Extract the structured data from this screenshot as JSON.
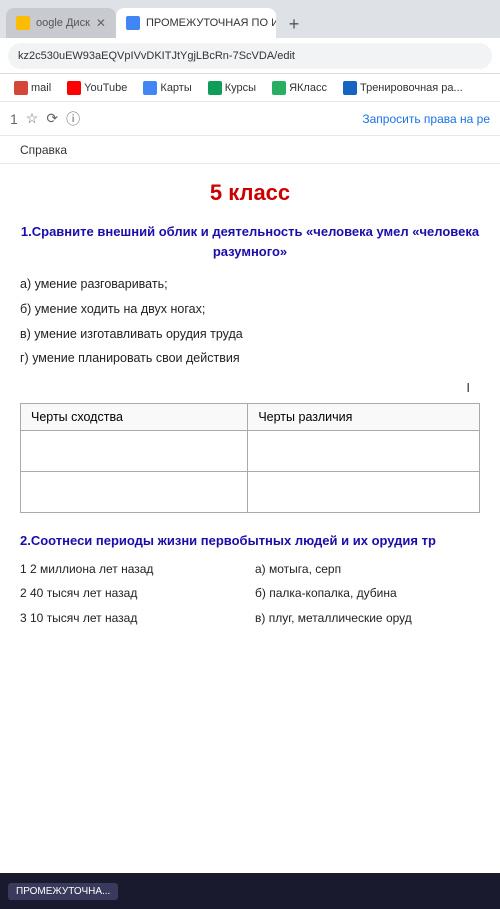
{
  "browser": {
    "tabs": [
      {
        "id": "tab1",
        "label": "oogle Диск",
        "active": false,
        "favicon": "drive"
      },
      {
        "id": "tab2",
        "label": "ПРОМЕЖУТОЧНАЯ ПО ИСТОР",
        "active": true,
        "favicon": "docs"
      }
    ],
    "address": "kz2c530uEW93aEQVpIVvDKITJtYgjLBcRn-7ScVDA/edit",
    "bookmarks": [
      {
        "id": "bm1",
        "label": "mail",
        "iconClass": "gmail"
      },
      {
        "id": "bm2",
        "label": "YouTube",
        "iconClass": "youtube"
      },
      {
        "id": "bm3",
        "label": "Карты",
        "iconClass": "maps"
      },
      {
        "id": "bm4",
        "label": "Курсы",
        "iconClass": "courses"
      },
      {
        "id": "bm5",
        "label": "ЯКласс",
        "iconClass": "yaklass"
      },
      {
        "id": "bm6",
        "label": "Тренировочная ра...",
        "iconClass": "train"
      }
    ],
    "toolbar_right": "Запросить права на ре",
    "menu_item": "Справка"
  },
  "page": {
    "title": "5 класс",
    "question1": {
      "text": "1.Сравните внешний облик и деятельность «человека умел «человека разумного»",
      "answers": [
        "а) умение разговаривать;",
        "б) умение ходить на двух ногах;",
        "в) умение изготавливать орудия труда",
        "г) умение планировать свои действия"
      ],
      "cursor_char": "I",
      "table": {
        "col1": "Черты сходства",
        "col2": "Черты различия"
      }
    },
    "question2": {
      "text": "2.Соотнеси периоды жизни первобытных людей и их орудия тр",
      "left_items": [
        "1 2 миллиона лет назад",
        "2 40 тысяч лет назад",
        "3 10 тысяч лет назад"
      ],
      "right_items": [
        "а) мотыга, серп",
        "б) палка-копалка, дубина",
        "в) плуг, металлические оруд"
      ]
    }
  },
  "taskbar": {
    "item_label": "ПРОМЕЖУТОЧНА..."
  }
}
